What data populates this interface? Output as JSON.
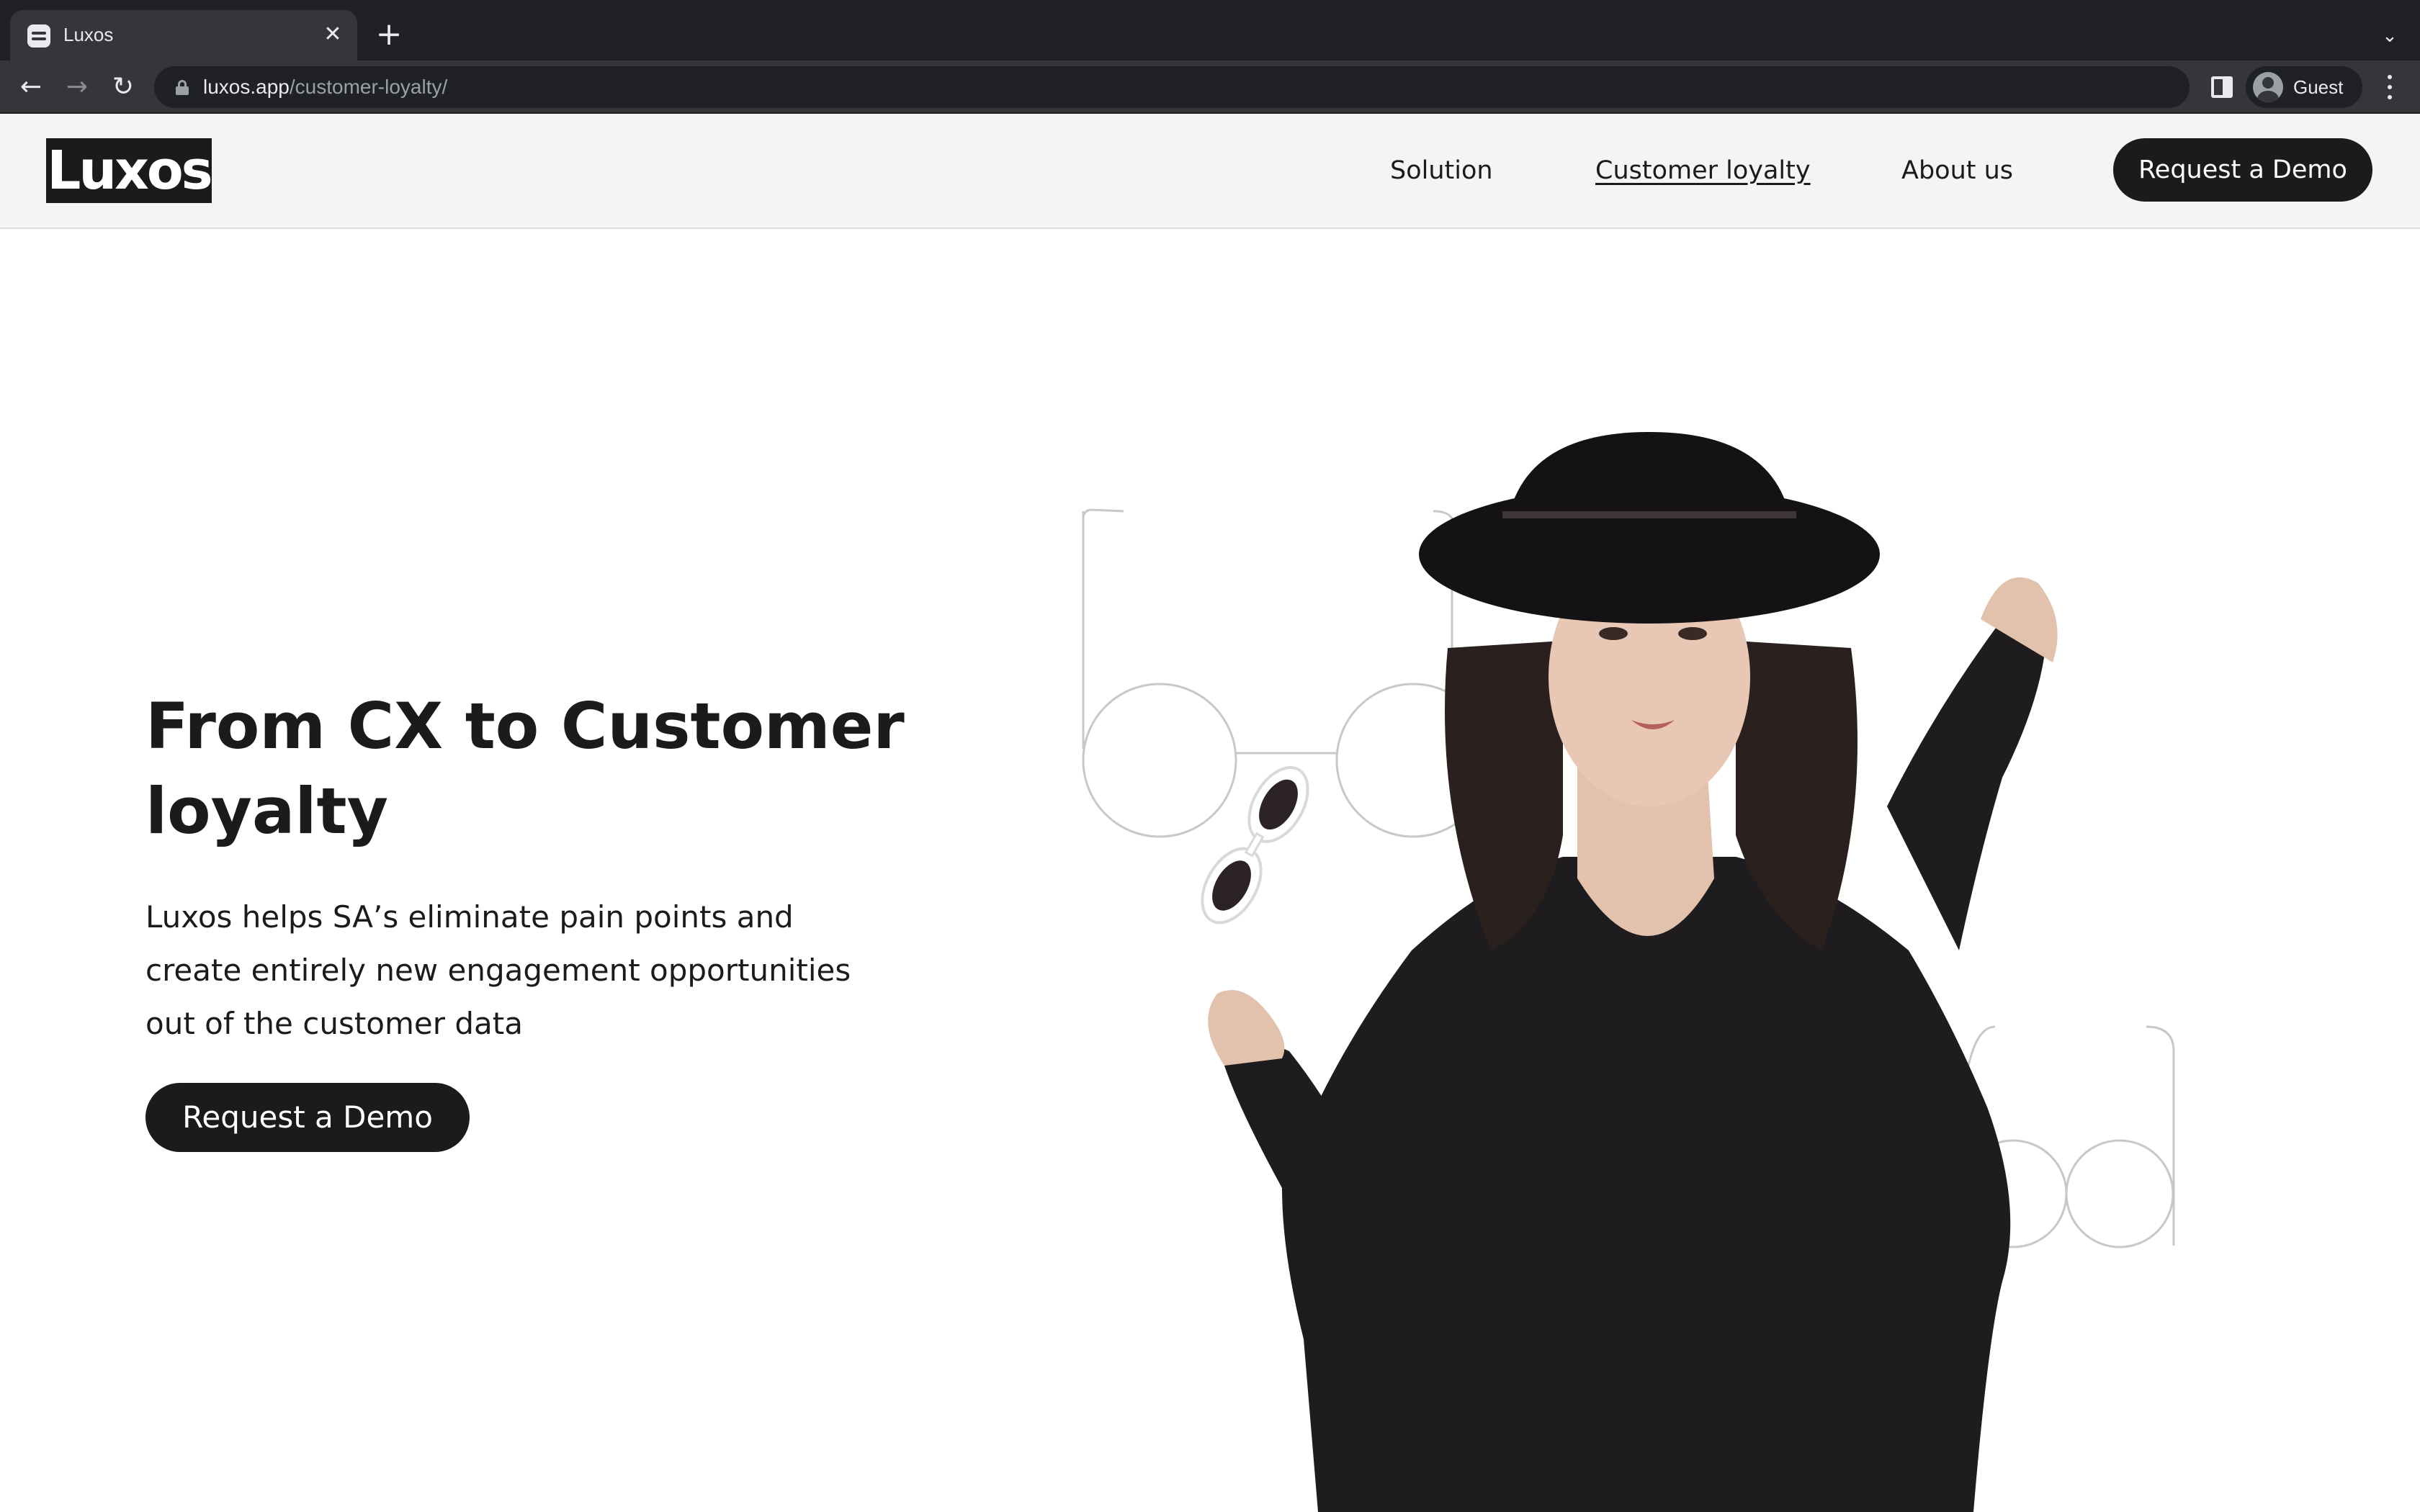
{
  "browser": {
    "tab_title": "Luxos",
    "tab_close_glyph": "✕",
    "new_tab_glyph": "+",
    "tab_menu_glyph": "⌄",
    "back_glyph": "←",
    "forward_glyph": "→",
    "reload_glyph": "↻",
    "url_host": "luxos.app",
    "url_path": "/customer-loyalty/",
    "profile_label": "Guest"
  },
  "site": {
    "logo_text": "Luxos",
    "nav": {
      "solution": "Solution",
      "customer_loyalty": "Customer loyalty",
      "about_us": "About us"
    },
    "header_cta": "Request a Demo",
    "hero": {
      "title": "From CX to Customer loyalty",
      "text": "Luxos helps SA’s eliminate pain points and create entirely new engagement opportunities out of the customer data",
      "cta": "Request a Demo"
    },
    "colors": {
      "brand_dark": "#1b1b1e",
      "header_bg": "#f4f4f5",
      "browser_frame": "#202124"
    }
  }
}
